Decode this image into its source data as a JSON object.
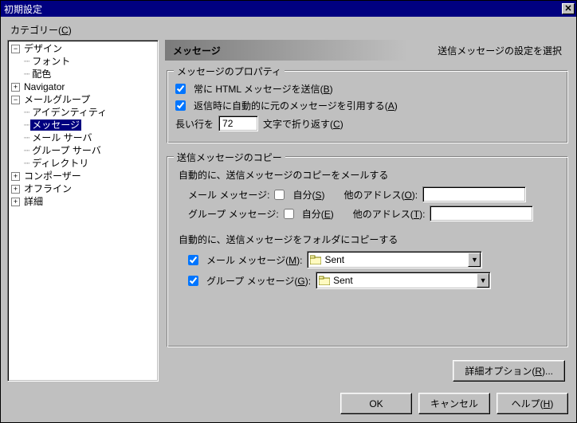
{
  "window": {
    "title": "初期設定"
  },
  "category": {
    "label": "カテゴリー",
    "access": "C"
  },
  "tree": {
    "design": "デザイン",
    "font": "フォント",
    "color": "配色",
    "navigator": "Navigator",
    "mailgroup": "メールグループ",
    "identity": "アイデンティティ",
    "messages": "メッセージ",
    "mailserver": "メール サーバ",
    "groupserver": "グループ サーバ",
    "directory": "ディレクトリ",
    "composer": "コンポーザー",
    "offline": "オフライン",
    "detail": "詳細"
  },
  "header": {
    "left": "メッセージ",
    "right": "送信メッセージの設定を選択"
  },
  "props": {
    "legend": "メッセージのプロパティ",
    "always_html_pre": "常に HTML メッセージを送信(",
    "always_html_key": "B",
    "always_html_post": ")",
    "quote_pre": "返信時に自動的に元のメッセージを引用する(",
    "quote_key": "A",
    "quote_post": ")",
    "wrap_pre": "長い行を",
    "wrap_value": "72",
    "wrap_mid": "文字で折り返す(",
    "wrap_key": "C",
    "wrap_post": ")"
  },
  "copies": {
    "legend": "送信メッセージのコピー",
    "mail_intro": "自動的に、送信メッセージのコピーをメールする",
    "mail_label": "メール メッセージ:",
    "group_label": "グループ メッセージ:",
    "self_pre": "自分(",
    "self_key_mail": "S",
    "self_key_group": "E",
    "self_post": ")",
    "other_pre": "他のアドレス(",
    "other_key_mail": "O",
    "other_key_group": "T",
    "other_post": ":",
    "folder_intro": "自動的に、送信メッセージをフォルダにコピーする",
    "folder_mail_pre": "メール メッセージ(",
    "folder_mail_key": "M",
    "folder_mail_post": "):",
    "folder_group_pre": "グループ メッセージ(",
    "folder_group_key": "G",
    "folder_group_post": "):",
    "sent_folder": "Sent"
  },
  "buttons": {
    "advanced_pre": "詳細オプション(",
    "advanced_key": "R",
    "advanced_post": ")...",
    "ok": "OK",
    "cancel": "キャンセル",
    "help_pre": "ヘルプ(",
    "help_key": "H",
    "help_post": ")"
  }
}
